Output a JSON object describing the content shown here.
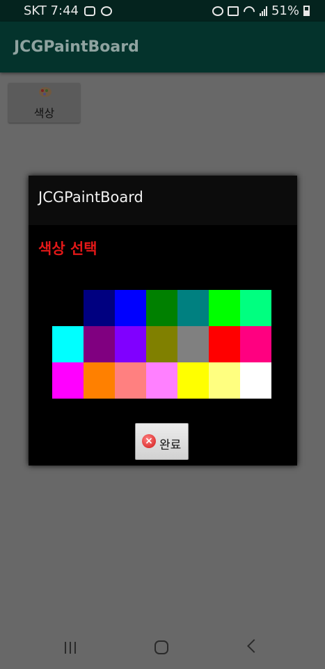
{
  "status_bar": {
    "carrier_time": "SKT 7:44",
    "battery": "51%",
    "icons": [
      "chat-icon",
      "talk-icon",
      "sync-icon",
      "alarm-icon",
      "mute-icon",
      "wifi-icon",
      "signal-icon",
      "battery-icon"
    ]
  },
  "app": {
    "title": "JCGPaintBoard"
  },
  "toolbar": {
    "color_button_label": "색상",
    "color_button_icon": "palette-icon"
  },
  "dialog": {
    "title": "JCGPaintBoard",
    "subtitle": "색상 선택",
    "subtitle_color": "#e31818",
    "done_label": "완료",
    "done_icon": "close-circle-icon",
    "colors": [
      [
        "#000000",
        "#000080",
        "#0000ff",
        "#008000",
        "#008080",
        "#00ff00",
        "#00ff80"
      ],
      [
        "#00ffff",
        "#800080",
        "#8000ff",
        "#808000",
        "#808080",
        "#ff0000",
        "#ff0080"
      ],
      [
        "#ff00ff",
        "#ff8000",
        "#ff8080",
        "#ff80ff",
        "#ffff00",
        "#ffff80",
        "#ffffff"
      ]
    ]
  },
  "nav_bar": {
    "icons": [
      "recent-apps-icon",
      "home-icon",
      "back-icon"
    ]
  }
}
